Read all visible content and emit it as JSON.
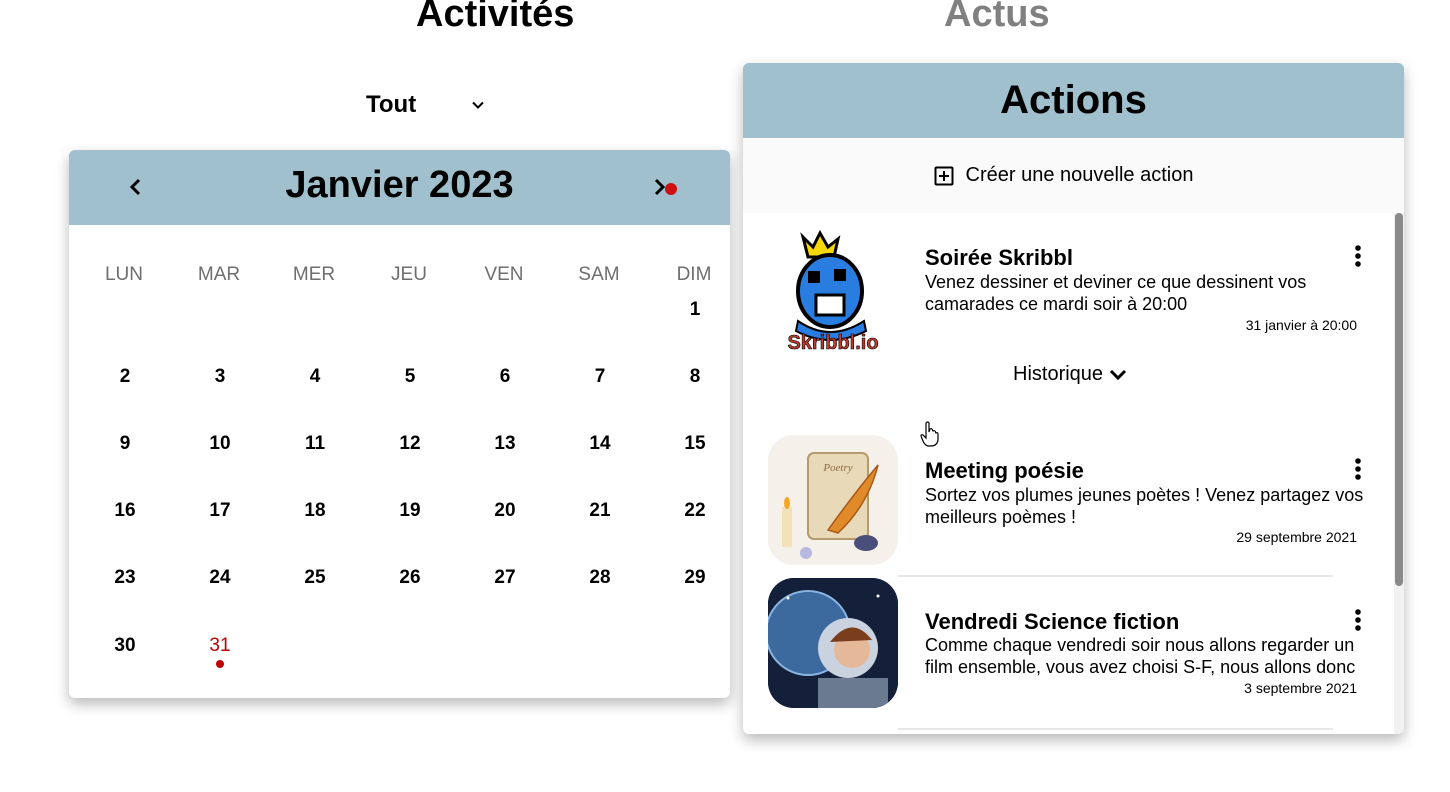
{
  "tabs": {
    "activities": "Activités",
    "news": "Actus"
  },
  "filter": {
    "selected": "Tout"
  },
  "calendar": {
    "month_title": "Janvier 2023",
    "weekdays": [
      "LUN",
      "MAR",
      "MER",
      "JEU",
      "VEN",
      "SAM",
      "DIM"
    ],
    "weeks": [
      [
        "",
        "",
        "",
        "",
        "",
        "",
        "1"
      ],
      [
        "2",
        "3",
        "4",
        "5",
        "6",
        "7",
        "8"
      ],
      [
        "9",
        "10",
        "11",
        "12",
        "13",
        "14",
        "15"
      ],
      [
        "16",
        "17",
        "18",
        "19",
        "20",
        "21",
        "22"
      ],
      [
        "23",
        "24",
        "25",
        "26",
        "27",
        "28",
        "29"
      ],
      [
        "30",
        "31",
        "",
        "",
        "",
        "",
        ""
      ]
    ],
    "today": "31",
    "event_color": "#d01010",
    "header_color": "#9fc0cc"
  },
  "actions": {
    "title": "Actions",
    "create_label": "Créer une nouvelle action",
    "history_label": "Historique",
    "items": [
      {
        "title": "Soirée Skribbl",
        "description": "Venez dessiner et deviner ce que dessinent vos camarades ce mardi soir à 20:00",
        "date": "31 janvier à 20:00",
        "image_text": "Skribbl.io"
      },
      {
        "title": "Meeting poésie",
        "description": "Sortez vos plumes jeunes poètes ! Venez partagez vos meilleurs poèmes !",
        "date": "29 septembre 2021",
        "image_text": "Poetry"
      },
      {
        "title": "Vendredi Science fiction",
        "description": "Comme chaque vendredi soir nous allons regarder un film ensemble, vous avez choisi S-F, nous allons donc",
        "date": "3 septembre 2021"
      }
    ]
  }
}
